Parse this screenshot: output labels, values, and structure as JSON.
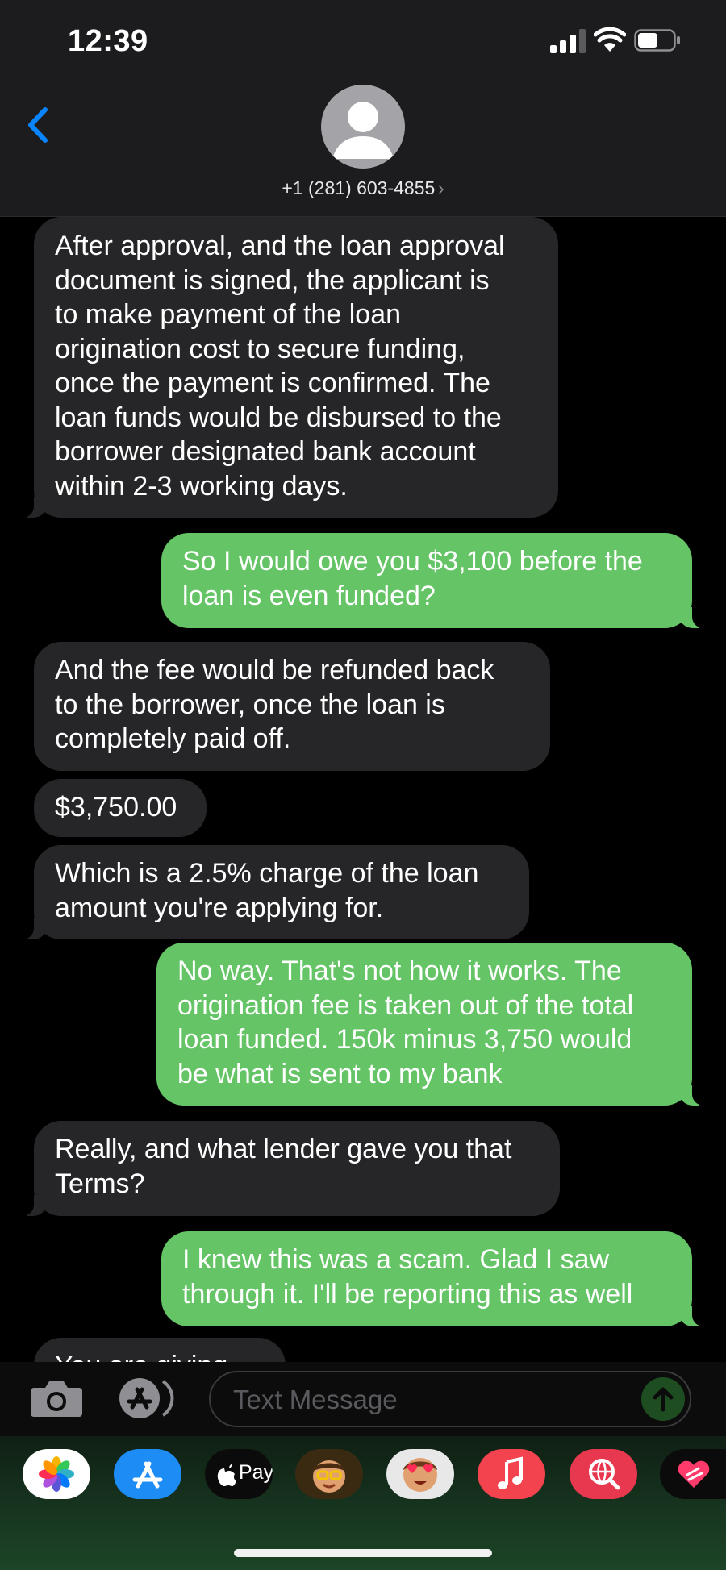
{
  "status_bar": {
    "time": "12:39"
  },
  "header": {
    "contact": "+1 (281) 603-4855",
    "chevron": "›"
  },
  "messages": [
    {
      "from": "in",
      "text": "After approval, and the loan approval\ndocument is signed, the applicant is\nto make payment of the loan\norigination cost to secure funding,\nonce the payment is confirmed. The\nloan funds would be disbursed to the\nborrower designated bank account\nwithin 2-3 working days."
    },
    {
      "from": "out",
      "text": "So I would owe you $3,100 before the\nloan is even funded?"
    },
    {
      "from": "in",
      "text": "And the fee would be refunded back\nto the borrower, once the loan is\ncompletely paid off."
    },
    {
      "from": "in",
      "text": "$3,750.00"
    },
    {
      "from": "in",
      "text": "Which is a 2.5% charge of the loan\namount you're applying for."
    },
    {
      "from": "out",
      "text": "No way. That's not how it works. The\norigination fee is taken out of the total\nloan funded. 150k minus 3,750 would\nbe what is sent to my bank"
    },
    {
      "from": "in",
      "text": "Really, and what lender gave you that\nTerms?"
    },
    {
      "from": "out",
      "text": "I knew this was a scam. Glad I saw\nthrough it. I'll be reporting this as well"
    },
    {
      "from": "in",
      "text": "You are giving still"
    }
  ],
  "input": {
    "placeholder": "Text Message"
  },
  "drawer": {
    "apps": [
      "photos-app",
      "app-store-app",
      "apple-pay-app",
      "memoji-app",
      "animoji-app",
      "music-app",
      "web-images-app",
      "digital-touch-app"
    ],
    "apple_pay_label": "Pay"
  },
  "colors": {
    "incoming": "#262628",
    "outgoing": "#65c466",
    "accent": "#0a84ff"
  }
}
